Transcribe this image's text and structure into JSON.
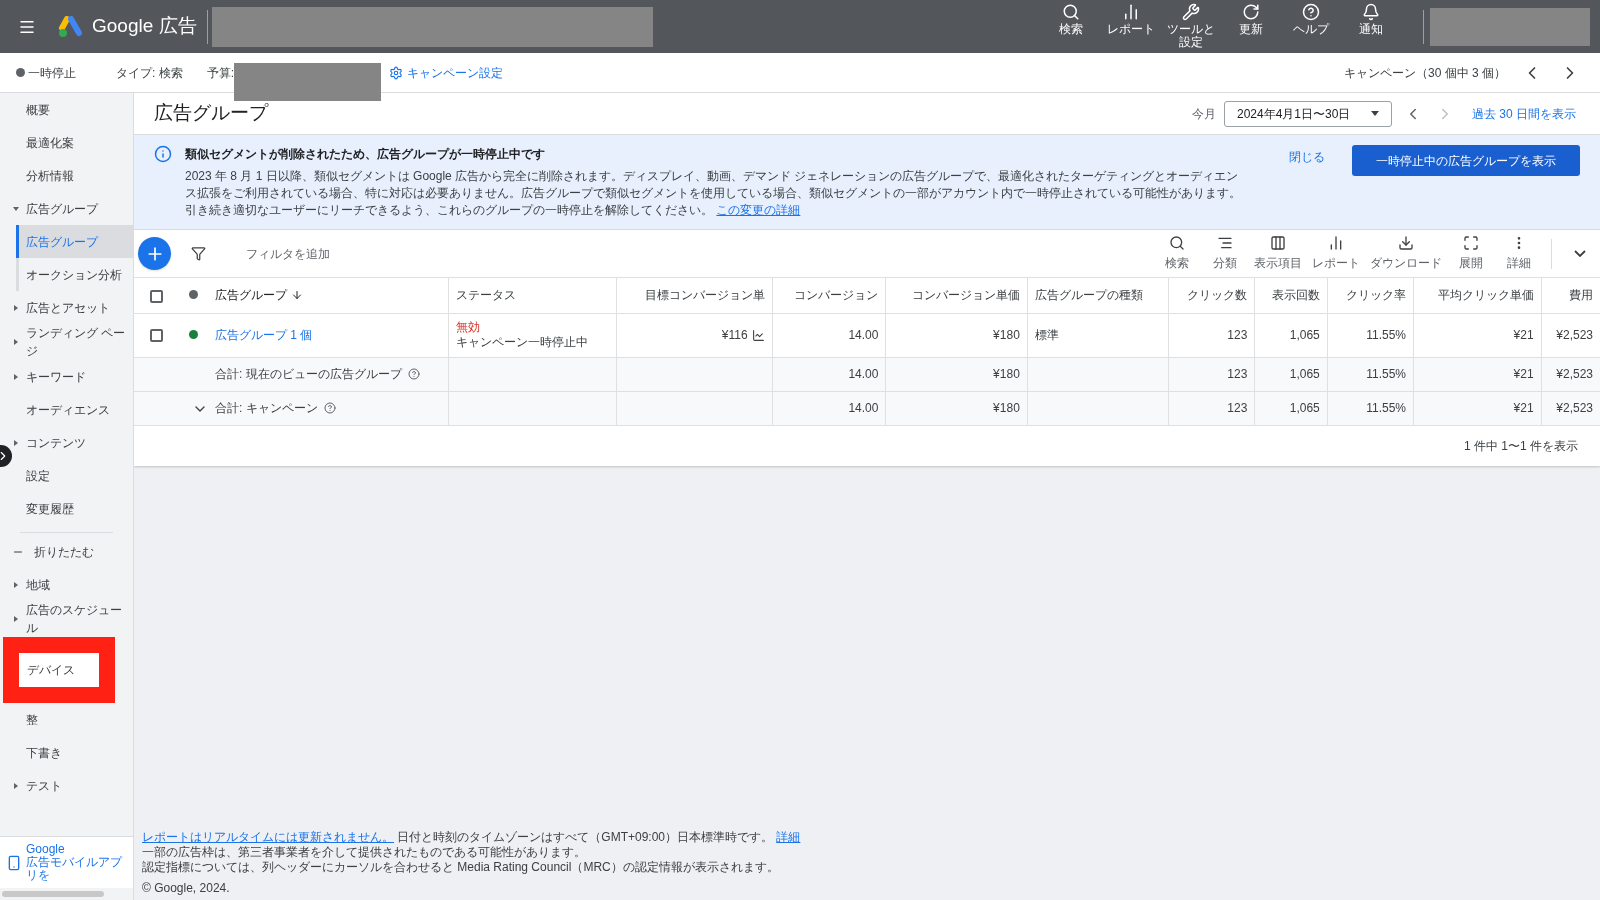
{
  "topbar": {
    "brand": "Google 広告",
    "actions": [
      {
        "kind": "search",
        "label": "検索"
      },
      {
        "kind": "report",
        "label": "レポート"
      },
      {
        "kind": "tools",
        "label": "ツールと設定"
      },
      {
        "kind": "refresh",
        "label": "更新"
      },
      {
        "kind": "help",
        "label": "ヘルプ"
      },
      {
        "kind": "bell",
        "label": "通知"
      }
    ]
  },
  "campaign_bar": {
    "status": "一時停止",
    "type": "タイプ: 検索",
    "budget": "予算:",
    "settings": "キャンペーン設定",
    "counter": "キャンペーン（30 個中 3 個）"
  },
  "sidebar": {
    "items": [
      {
        "label": "概要",
        "selected": false
      },
      {
        "label": "最適化案",
        "selected": false
      },
      {
        "label": "分析情報",
        "selected": false
      },
      {
        "label": "広告グループ",
        "selected": false,
        "expanded": true,
        "children": [
          {
            "label": "広告グループ",
            "selected": true
          },
          {
            "label": "オークション分析",
            "selected": false
          }
        ]
      },
      {
        "label": "広告とアセット",
        "selected": false,
        "expanded": false
      },
      {
        "label": "ランディング ページ",
        "selected": false,
        "expanded": false
      },
      {
        "label": "キーワード",
        "selected": false,
        "expanded": false
      },
      {
        "label": "オーディエンス",
        "selected": false
      },
      {
        "label": "コンテンツ",
        "selected": false,
        "expanded": false
      },
      {
        "label": "設定",
        "selected": false
      },
      {
        "label": "変更履歴",
        "selected": false
      }
    ],
    "collapse": "折りたたむ",
    "more_items": [
      {
        "label": "地域",
        "selected": false,
        "expanded": false
      },
      {
        "label": "広告のスケジュール",
        "selected": false,
        "expanded": false
      },
      {
        "label": "デバイス",
        "selected": false,
        "highlighted": true
      },
      {
        "label": "整",
        "selected": false
      },
      {
        "label": "下書き",
        "selected": false
      },
      {
        "label": "テスト",
        "selected": false,
        "expanded": false
      }
    ],
    "app_promo": {
      "title": "Google",
      "text": "広告モバイルアプリを"
    }
  },
  "page": {
    "title": "広告グループ",
    "period_label": "今月",
    "date_range": "2024年4月1日〜30日",
    "show_last": "過去 30 日間を表示"
  },
  "notice": {
    "title": "類似セグメントが削除されたため、広告グループが一時停止中です",
    "body": "2023 年 8 月 1 日以降、類似セグメントは Google 広告から完全に削除されます。ディスプレイ、動画、デマンド ジェネレーションの広告グループで、最適化されたターゲティングとオーディエンス拡張をご利用されている場合、特に対応は必要ありません。広告グループで類似セグメントを使用している場合、類似セグメントの一部がアカウント内で一時停止されている可能性があります。引き続き適切なユーザーにリーチできるよう、これらのグループの一時停止を解除してください。",
    "link": "この変更の詳細",
    "close": "閉じる",
    "action": "一時停止中の広告グループを表示"
  },
  "toolbar": {
    "filter_placeholder": "フィルタを追加",
    "tools": [
      {
        "kind": "search",
        "label": "検索"
      },
      {
        "kind": "segment",
        "label": "分類"
      },
      {
        "kind": "columns",
        "label": "表示項目"
      },
      {
        "kind": "report",
        "label": "レポート"
      },
      {
        "kind": "download",
        "label": "ダウンロード"
      },
      {
        "kind": "expand",
        "label": "展開"
      },
      {
        "kind": "more",
        "label": "詳細"
      }
    ]
  },
  "table": {
    "all_checked": false,
    "columns": [
      "広告グループ",
      "ステータス",
      "目標コンバージョン単",
      "コンバージョン",
      "コンバージョン単価",
      "広告グループの種類",
      "クリック数",
      "表示回数",
      "クリック率",
      "平均クリック単価",
      "費用"
    ],
    "rows": [
      {
        "kind": "item",
        "checked": false,
        "color": "#188038",
        "cells": [
          "広告グループ 1 個",
          "",
          "¥116",
          "14.00",
          "¥180",
          "標準",
          "123",
          "1,065",
          "11.55%",
          "¥21",
          "¥2,523"
        ],
        "status": "無効",
        "status_detail": "キャンペーン一時停止中"
      },
      {
        "kind": "total",
        "cells": [
          "合計: 現在のビューの広告グループ",
          "",
          "",
          "14.00",
          "¥180",
          "",
          "123",
          "1,065",
          "11.55%",
          "¥21",
          "¥2,523"
        ]
      },
      {
        "kind": "campaign_total",
        "expanded": false,
        "cells": [
          "合計: キャンペーン",
          "",
          "",
          "14.00",
          "¥180",
          "",
          "123",
          "1,065",
          "11.55%",
          "¥21",
          "¥2,523"
        ]
      }
    ],
    "pagination": "1 件中 1〜1 件を表示"
  },
  "footer": {
    "link": "レポートはリアルタイムには更新されません。",
    "tz": "日付と時刻のタイムゾーンはすべて（GMT+09:00）日本標準時です。",
    "tz_link": "詳細",
    "line2": "一部の広告枠は、第三者事業者を介して提供されたものである可能性があります。",
    "line3": "認定指標については、列ヘッダーにカーソルを合わせると Media Rating Council（MRC）の認定情報が表示されます。",
    "copyright": "© Google, 2024."
  }
}
